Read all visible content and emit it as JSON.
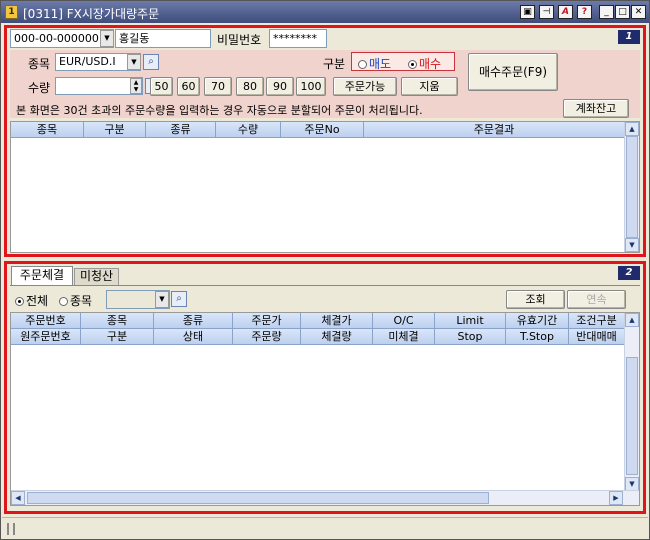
{
  "window": {
    "title": "[0311] FX시장가대량주문",
    "app_icon": "1",
    "title_buttons": [
      "save-layout-icon",
      "pin-icon",
      "font-icon",
      "help-icon",
      "minimize-icon",
      "maximize-icon",
      "close-icon"
    ],
    "title_glyphs": [
      "▣",
      "⊣",
      "A",
      "?",
      "_",
      "□",
      "✕"
    ]
  },
  "section1": {
    "badge": "1",
    "account": {
      "number": "000-00-000000",
      "name": "홍길동",
      "password_label": "비밀번호",
      "password_value": "********"
    },
    "symbol_label": "종목",
    "symbol_value": "EUR/USD.I",
    "side_label": "구분",
    "side_sell": "매도",
    "side_buy": "매수",
    "qty_label": "수량",
    "qty_value": "",
    "qty_presets": [
      "50",
      "60",
      "70",
      "80",
      "90",
      "100"
    ],
    "available_button": "주문가능",
    "clear_button": "지움",
    "submit_button": "매수주문(F9)",
    "balance_button": "계좌잔고",
    "notice": "본 화면은 30건 초과의 주문수량을 입력하는 경우 자동으로 분할되어 주문이 처리됩니다.",
    "grid_headers": [
      "종목",
      "구분",
      "종류",
      "수량",
      "주문No",
      "주문결과"
    ]
  },
  "section2": {
    "badge": "2",
    "tabs": [
      "주문체결",
      "미청산"
    ],
    "filter_all": "전체",
    "filter_symbol": "종목",
    "filter_value": "",
    "query_button": "조회",
    "next_button": "연속",
    "headers_row1": [
      "주문번호",
      "종목",
      "종류",
      "주문가",
      "체결가",
      "O/C",
      "Limit",
      "유효기간",
      "조건구분"
    ],
    "headers_row2": [
      "원주문번호",
      "구분",
      "상태",
      "주문량",
      "체결량",
      "미체결",
      "Stop",
      "T.Stop",
      "반대매매"
    ]
  },
  "colors": {
    "section_border": "#e0141b",
    "form_background": "#f1d3cd",
    "header_blue": "#c9daf4",
    "badge": "#1f2b6b"
  }
}
